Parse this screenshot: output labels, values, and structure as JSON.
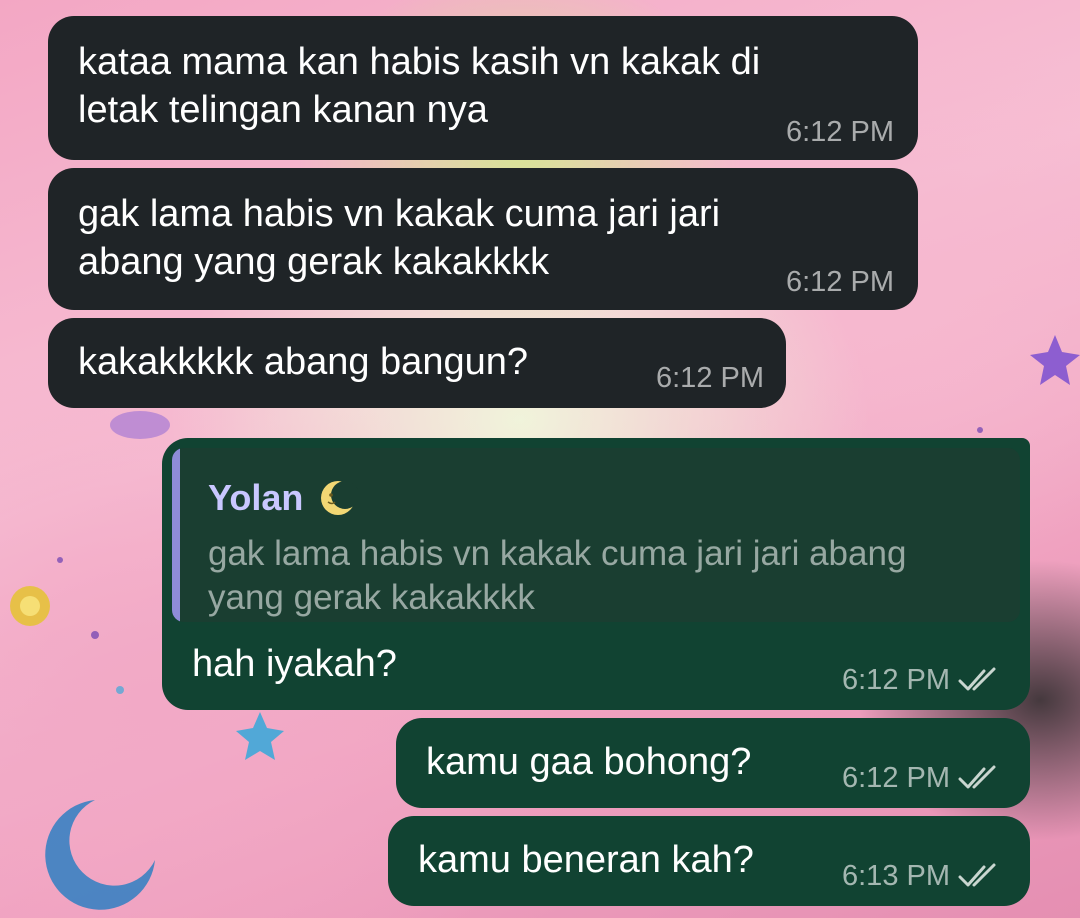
{
  "messages": [
    {
      "id": "m1",
      "direction": "incoming",
      "text": "kataa mama kan habis kasih vn kakak di\nletak telingan kanan nya",
      "time": "6:12 PM"
    },
    {
      "id": "m2",
      "direction": "incoming",
      "text": "gak lama habis vn kakak cuma jari jari\nabang yang gerak kakakkkk",
      "time": "6:12 PM"
    },
    {
      "id": "m3",
      "direction": "incoming",
      "text": "kakakkkkk abang bangun?",
      "time": "6:12 PM"
    },
    {
      "id": "m4",
      "direction": "outgoing",
      "reply_to": {
        "sender": "Yolan",
        "sender_emoji": "moon-icon",
        "text": "gak lama habis vn kakak cuma jari jari abang\nyang gerak kakakkkk"
      },
      "text": "hah iyakah?",
      "time": "6:12 PM",
      "status": "read-double-check-icon"
    },
    {
      "id": "m5",
      "direction": "outgoing",
      "text": "kamu gaa bohong?",
      "time": "6:12 PM",
      "status": "read-double-check-icon"
    },
    {
      "id": "m6",
      "direction": "outgoing",
      "text": "kamu beneran kah?",
      "time": "6:13 PM",
      "status": "read-double-check-icon"
    }
  ],
  "colors": {
    "incoming_bubble": "#1f2427",
    "outgoing_bubble": "#114332",
    "reply_accent": "#8e8cd8",
    "reply_sender": "#c9c7ff",
    "wallpaper_pink": "#f3a7c4"
  }
}
